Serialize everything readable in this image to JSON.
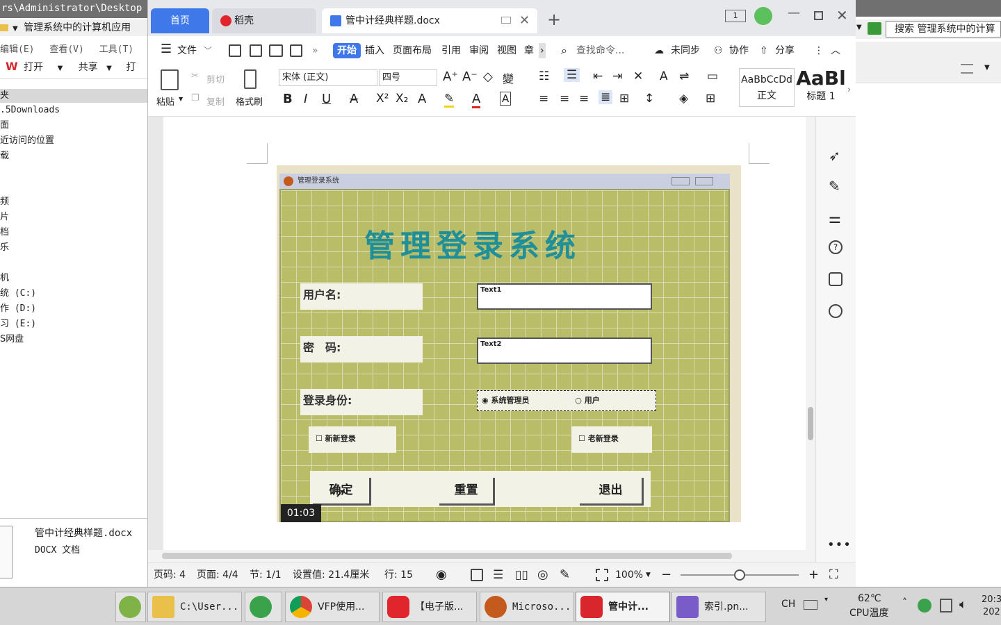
{
  "explorer": {
    "path": "rs\\Administrator\\Desktop",
    "address_text": "管理系统中的计算机应用",
    "menu": [
      "编辑(E)",
      "查看(V)",
      "工具(T)"
    ],
    "toolbar": {
      "open": "打开",
      "share": "共享",
      "print": "打"
    },
    "tree_header": "夹",
    "tree_items": [
      ".5Downloads",
      "面",
      "近访问的位置",
      "载",
      "",
      "",
      "频",
      "片",
      "档",
      "乐",
      "",
      "机",
      "统 (C:)",
      "作 (D:)",
      "习 (E:)",
      "S网盘"
    ],
    "file_name": "管中计经典样题.docx",
    "file_type": "DOCX 文档"
  },
  "right_window": {
    "search_label": "搜索 管理系统中的计算"
  },
  "wps": {
    "tabs": {
      "home": "首页",
      "daoke": "稻壳",
      "doc": "管中计经典样题.docx"
    },
    "menu": {
      "file": "文件",
      "items": [
        "开始",
        "插入",
        "页面布局",
        "引用",
        "审阅",
        "视图",
        "章"
      ],
      "search_placeholder": "查找命令...",
      "sync": "未同步",
      "collab": "协作",
      "share": "分享"
    },
    "ribbon": {
      "paste": "粘贴",
      "cut": "剪切",
      "copy": "复制",
      "format_painter": "格式刷",
      "font": "宋体 (正文)",
      "size": "四号",
      "style_normal_preview": "AaBbCcDd",
      "style_normal": "正文",
      "style_h1_preview": "AaBl",
      "style_h1": "标题 1"
    },
    "status": {
      "page_code": "页码: 4",
      "pages": "页面: 4/4",
      "section": "节: 1/1",
      "setting": "设置值: 21.4厘米",
      "line": "行: 15",
      "zoom": "100%"
    },
    "zoom_level": 0.5
  },
  "video": {
    "window_title": "管理登录系统",
    "heading": "管理登录系统",
    "label_user": "用户名:",
    "label_pwd": "密　码:",
    "label_role": "登录身份:",
    "text1": "Text1",
    "text2": "Text2",
    "radio_admin": "系统管理员",
    "radio_user": "用户",
    "check_new": "新新登录",
    "check_old": "老新登录",
    "btn_ok": "确定",
    "btn_reset": "重置",
    "btn_exit": "退出",
    "timestamp": "01:03"
  },
  "taskbar": {
    "items": [
      "C:\\User...",
      "VFP使用...",
      "【电子版...",
      "Microso...",
      "管中计...",
      "索引.pn..."
    ],
    "lang": "CH",
    "temp": "62℃",
    "temp_label": "CPU温度",
    "time": "20:3",
    "date": "202"
  },
  "colors": {
    "wps_blue": "#3f79e9",
    "form_green": "#b9bd68",
    "title_teal": "#1f8f9a"
  }
}
